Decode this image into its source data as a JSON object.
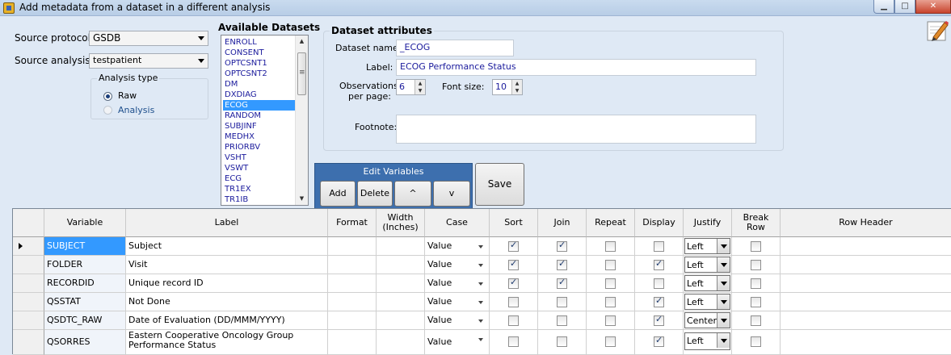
{
  "window": {
    "title": "Add metadata from a dataset in a different analysis"
  },
  "source": {
    "protocol_label": "Source protocol",
    "protocol_value": "GSDB",
    "analysis_label": "Source analysis",
    "analysis_value": "testpatient",
    "analysis_type_title": "Analysis type",
    "analysis_type_options": [
      "Raw",
      "Analysis"
    ],
    "analysis_type_selected": "Raw"
  },
  "available": {
    "title": "Available Datasets",
    "items": [
      "ENROLL",
      "CONSENT",
      "OPTCSNT1",
      "OPTCSNT2",
      "DM",
      "DXDIAG",
      "ECOG",
      "RANDOM",
      "SUBJINF",
      "MEDHX",
      "PRIORBV",
      "VSHT",
      "VSWT",
      "ECG",
      "TR1EX",
      "TR1IB"
    ],
    "selected": "ECOG"
  },
  "attributes": {
    "title": "Dataset attributes",
    "name_label": "Dataset name:",
    "name_value": "_ECOG",
    "label_label": "Label:",
    "label_value": "ECOG Performance Status",
    "obs_label_1": "Observations",
    "obs_label_2": "per page:",
    "obs_value": "6",
    "font_label": "Font size:",
    "font_value": "10",
    "footnote_label": "Footnote:",
    "footnote_value": ""
  },
  "edit_vars": {
    "title": "Edit Variables",
    "add": "Add",
    "delete": "Delete",
    "up": "^",
    "down": "v"
  },
  "save_label": "Save",
  "grid": {
    "headers": {
      "variable": "Variable",
      "label": "Label",
      "format": "Format",
      "width_1": "Width",
      "width_2": "(Inches)",
      "case": "Case",
      "sort": "Sort",
      "join": "Join",
      "repeat": "Repeat",
      "display": "Display",
      "justify": "Justify",
      "break_1": "Break",
      "break_2": "Row",
      "row_header": "Row Header"
    },
    "rows": [
      {
        "variable": "SUBJECT",
        "label": "Subject",
        "case": "Value",
        "sort": true,
        "join": true,
        "repeat": false,
        "display": false,
        "justify": "Left",
        "break_row": false
      },
      {
        "variable": "FOLDER",
        "label": "Visit",
        "case": "Value",
        "sort": true,
        "join": true,
        "repeat": false,
        "display": true,
        "justify": "Left",
        "break_row": false
      },
      {
        "variable": "RECORDID",
        "label": "Unique record ID",
        "case": "Value",
        "sort": true,
        "join": true,
        "repeat": false,
        "display": false,
        "justify": "Left",
        "break_row": false
      },
      {
        "variable": "QSSTAT",
        "label": "Not Done",
        "case": "Value",
        "sort": false,
        "join": false,
        "repeat": false,
        "display": true,
        "justify": "Left",
        "break_row": false
      },
      {
        "variable": "QSDTC_RAW",
        "label": "Date of Evaluation (DD/MMM/YYYY)",
        "case": "Value",
        "sort": false,
        "join": false,
        "repeat": false,
        "display": true,
        "justify": "Center",
        "break_row": false
      },
      {
        "variable": "QSORRES",
        "label": "Eastern Cooperative Oncology Group Performance Status",
        "case": "Value",
        "sort": false,
        "join": false,
        "repeat": false,
        "display": true,
        "justify": "Left",
        "break_row": false
      }
    ]
  },
  "colors": {
    "accent": "#3399ff",
    "panel_blue": "#3d6fae",
    "background": "#dfe9f5",
    "link_text": "#1a1a9c"
  }
}
